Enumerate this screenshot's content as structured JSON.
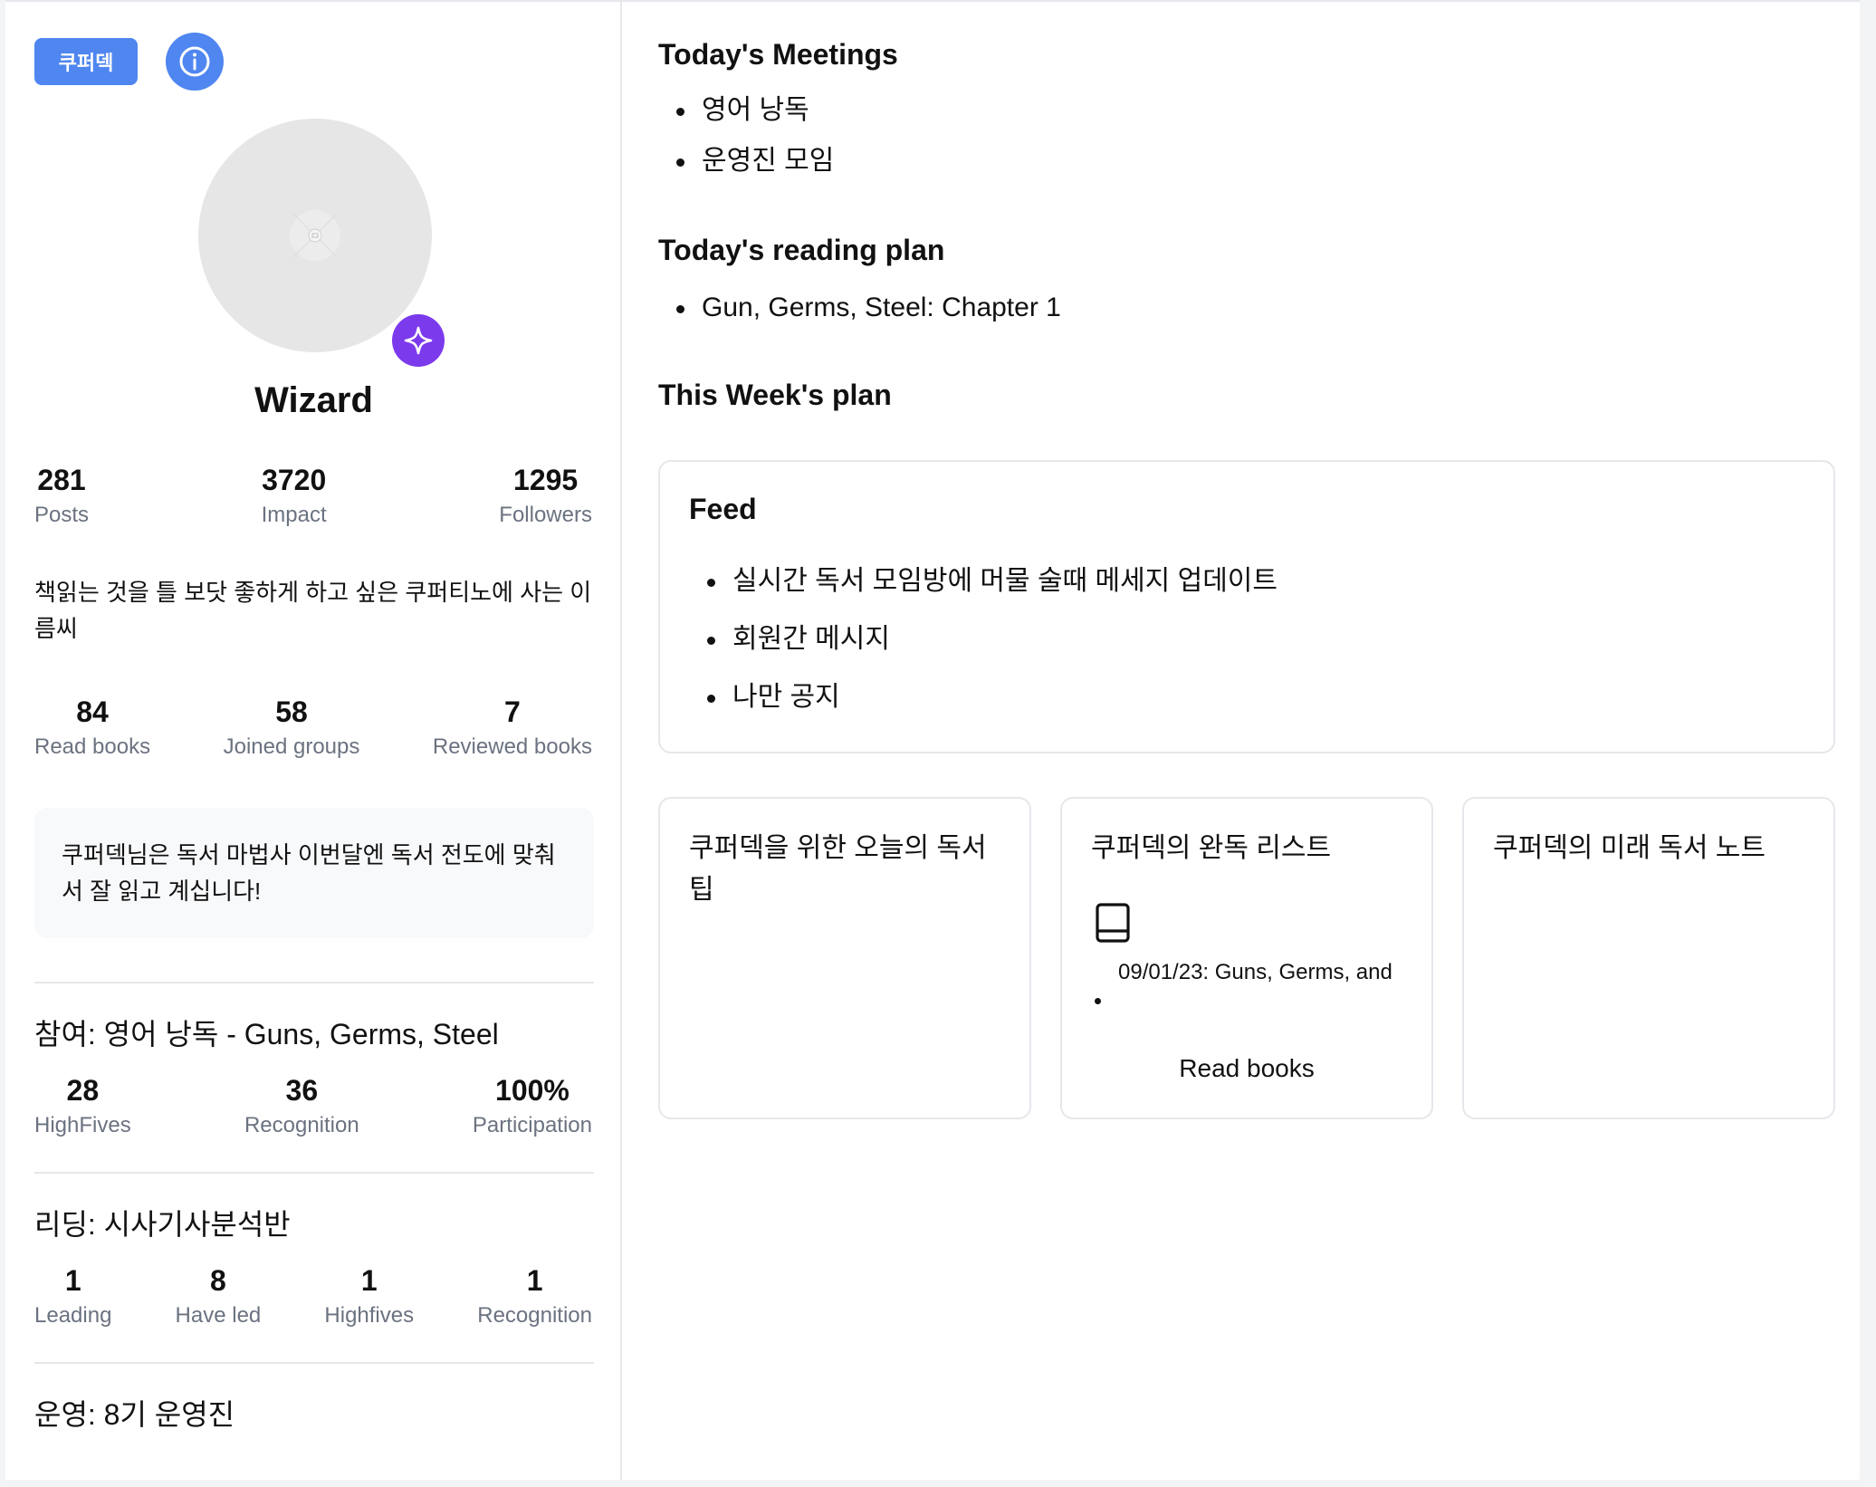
{
  "sidebar": {
    "brand_label": "쿠퍼덱",
    "info_icon": "info-icon",
    "badge_icon": "sparkle-icon",
    "profile_name": "Wizard",
    "stats": [
      {
        "value": "281",
        "label": "Posts"
      },
      {
        "value": "3720",
        "label": "Impact"
      },
      {
        "value": "1295",
        "label": "Followers"
      }
    ],
    "bio": "책읽는 것을 틀 보닷 좋하게 하고 싶은 쿠퍼티노에 사는 이름씨",
    "book_stats": [
      {
        "value": "84",
        "label": "Read books"
      },
      {
        "value": "58",
        "label": "Joined groups"
      },
      {
        "value": "7",
        "label": "Reviewed books"
      }
    ],
    "callout": "쿠퍼덱님은 독서 마법사 이번달엔 독서 전도에 맞춰서 잘 읽고 계십니다!",
    "participation": {
      "title": "참여: 영어 낭독 - Guns, Germs, Steel",
      "stats": [
        {
          "value": "28",
          "label": "HighFives"
        },
        {
          "value": "36",
          "label": "Recognition"
        },
        {
          "value": "100%",
          "label": "Participation"
        }
      ]
    },
    "leading": {
      "title": "리딩: 시사기사분석반",
      "stats": [
        {
          "value": "1",
          "label": "Leading"
        },
        {
          "value": "8",
          "label": "Have led"
        },
        {
          "value": "1",
          "label": "Highfives"
        },
        {
          "value": "1",
          "label": "Recognition"
        }
      ]
    },
    "operating": {
      "title": "운영: 8기 운영진"
    }
  },
  "main": {
    "meetings_title": "Today's Meetings",
    "meetings": [
      "영어 낭독",
      "운영진 모임"
    ],
    "reading_title": "Today's reading plan",
    "reading": [
      "Gun, Germs, Steel: Chapter 1"
    ],
    "week_title": "This Week's plan",
    "feed": {
      "title": "Feed",
      "items": [
        "실시간 독서 모임방에 머물 술때 메세지 업데이트",
        "회원간 메시지",
        "나만 공지"
      ]
    },
    "cards": [
      {
        "title": "쿠퍼덱을 위한 오늘의 독서 팁"
      },
      {
        "title": "쿠퍼덱의 완독 리스트",
        "icon": "book-icon",
        "entry": "09/01/23: Guns, Germs, and",
        "footer": "Read books"
      },
      {
        "title": "쿠퍼덱의 미래 독서 노트"
      }
    ]
  }
}
